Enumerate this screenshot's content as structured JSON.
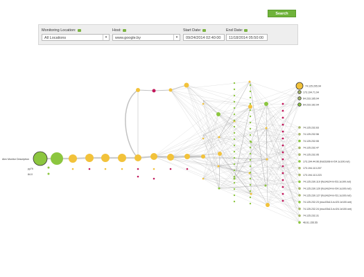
{
  "filters": {
    "location": {
      "label": "Monitoring Location:",
      "value": "All Locations"
    },
    "host": {
      "label": "Host:",
      "value": "www.google.by"
    },
    "start": {
      "label": "Start Date:",
      "value": "09/24/2014 02:40:00"
    },
    "end": {
      "label": "End Date:",
      "value": "11/18/2014 05:50:00"
    },
    "search_label": "Search"
  },
  "graph": {
    "source_label": "Alex Monitor Description",
    "left_labels": [
      "py79",
      "84.0"
    ],
    "right_labels": [
      "74.125.205.94",
      "173.194.71.94",
      "64.233.165.94",
      "64.233.162.94",
      "74.125.232.63",
      "74.125.232.56",
      "74.125.232.55",
      "74.125.232.47",
      "74.125.232.95",
      "173.194.44.96 (fra02s08-in-f24.1e100.net)",
      "173.194.113.207",
      "173.194.113.223",
      "74.125.230.119 (fra14s24-in-f23.1e100.net)",
      "74.125.230.120 (fra14s24-in-f24.1e100.net)",
      "74.125.230.127 (fra14s24-in-f31.1e100.net)",
      "74.125.232.23 (muc03s13-in-f23.1e100.net)",
      "74.125.232.24 (muc03s13-in-f24.1e100.net)",
      "74.125.232.31",
      "46.61.155.55"
    ],
    "colors": {
      "yellow": "#f2c23a",
      "green": "#8cc63f",
      "magenta": "#c2185b",
      "edge": "#999999"
    }
  }
}
